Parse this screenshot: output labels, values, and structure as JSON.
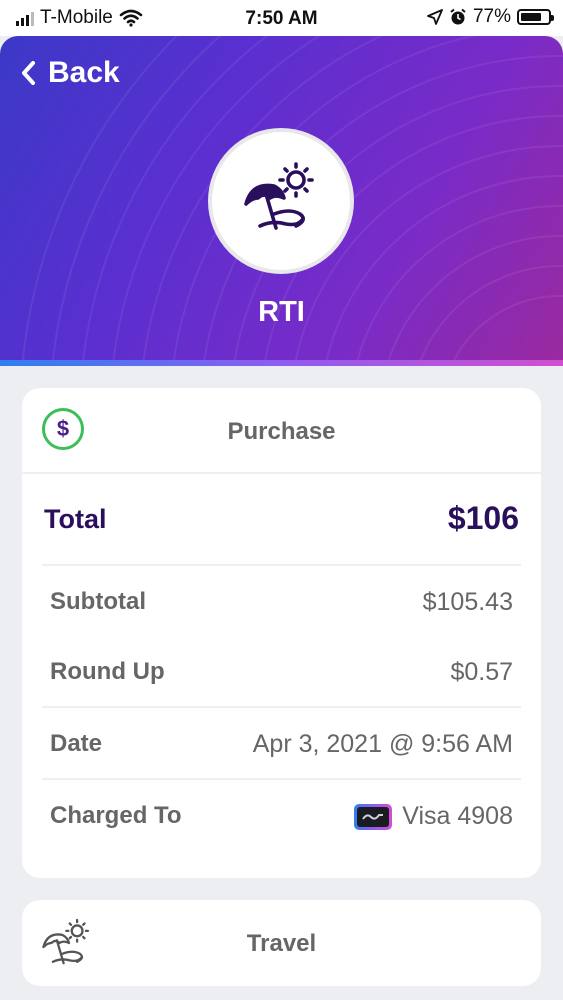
{
  "status": {
    "carrier": "T-Mobile",
    "time": "7:50 AM",
    "battery": "77%",
    "battery_level": 0.77
  },
  "header": {
    "back_label": "Back",
    "merchant": "RTI",
    "merchant_icon": "beach-umbrella-icon",
    "colors": {
      "gradient_start": "#3b39c7",
      "gradient_end": "#9a2a9e"
    }
  },
  "purchase": {
    "title": "Purchase",
    "icon_symbol": "$",
    "total_label": "Total",
    "total_value": "$106",
    "rows": [
      {
        "label": "Subtotal",
        "value": "$105.43"
      },
      {
        "label": "Round Up",
        "value": "$0.57"
      },
      {
        "label": "Date",
        "value": "Apr 3, 2021 @ 9:56 AM"
      },
      {
        "label": "Charged To",
        "value": "Visa 4908"
      }
    ]
  },
  "category": {
    "title": "Travel",
    "icon": "beach-umbrella-icon"
  },
  "colors": {
    "accent_dark": "#2a0f5c",
    "dollar_ring": "#3cbf5a"
  }
}
